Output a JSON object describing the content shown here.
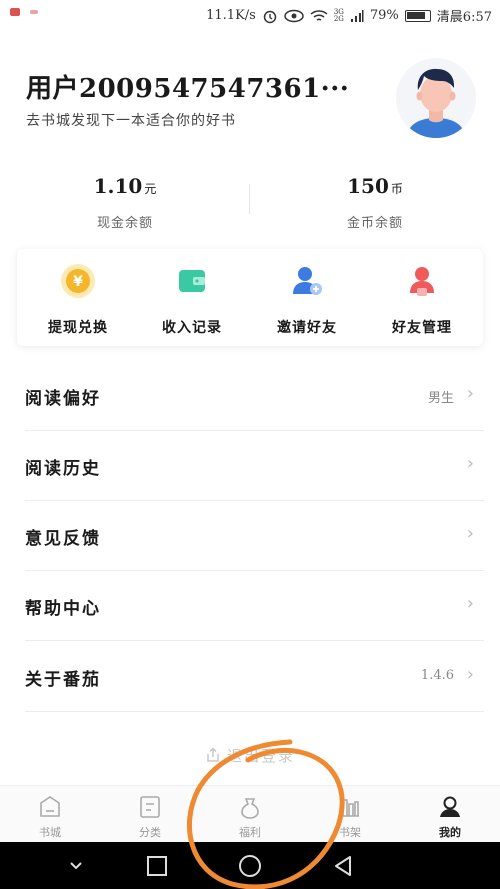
{
  "status_bar": {
    "network_speed": "11.1K/s",
    "network_type_top": "3G",
    "network_type_bottom": "2G",
    "battery": "79%",
    "time": "清晨6:57"
  },
  "profile": {
    "username": "用户2009547547361···",
    "tagline": "去书城发现下一本适合你的好书"
  },
  "balances": {
    "cash": {
      "value": "1.10",
      "unit": "元",
      "label": "现金余额"
    },
    "coins": {
      "value": "150",
      "unit": "币",
      "label": "金币余额"
    }
  },
  "quick_actions": [
    {
      "label": "提现兑换",
      "icon": "coin-icon"
    },
    {
      "label": "收入记录",
      "icon": "wallet-icon"
    },
    {
      "label": "邀请好友",
      "icon": "invite-user-icon"
    },
    {
      "label": "好友管理",
      "icon": "friend-manage-icon"
    }
  ],
  "menu": [
    {
      "title": "阅读偏好",
      "value": "男生"
    },
    {
      "title": "阅读历史",
      "value": ""
    },
    {
      "title": "意见反馈",
      "value": ""
    },
    {
      "title": "帮助中心",
      "value": ""
    },
    {
      "title": "关于番茄",
      "value": "1.4.6"
    }
  ],
  "logout_label": "退出登录",
  "tabs": [
    {
      "label": "书城",
      "icon": "bookstore-icon",
      "active": false
    },
    {
      "label": "分类",
      "icon": "category-icon",
      "active": false
    },
    {
      "label": "福利",
      "icon": "gift-icon",
      "active": false
    },
    {
      "label": "书架",
      "icon": "bookshelf-icon",
      "active": false
    },
    {
      "label": "我的",
      "icon": "profile-icon",
      "active": true
    }
  ],
  "colors": {
    "accent_coin": "#f5b629",
    "accent_wallet": "#3bc9a4",
    "accent_invite": "#3d7be0",
    "accent_friend": "#ef5a5a",
    "annotation": "#f08a32"
  }
}
